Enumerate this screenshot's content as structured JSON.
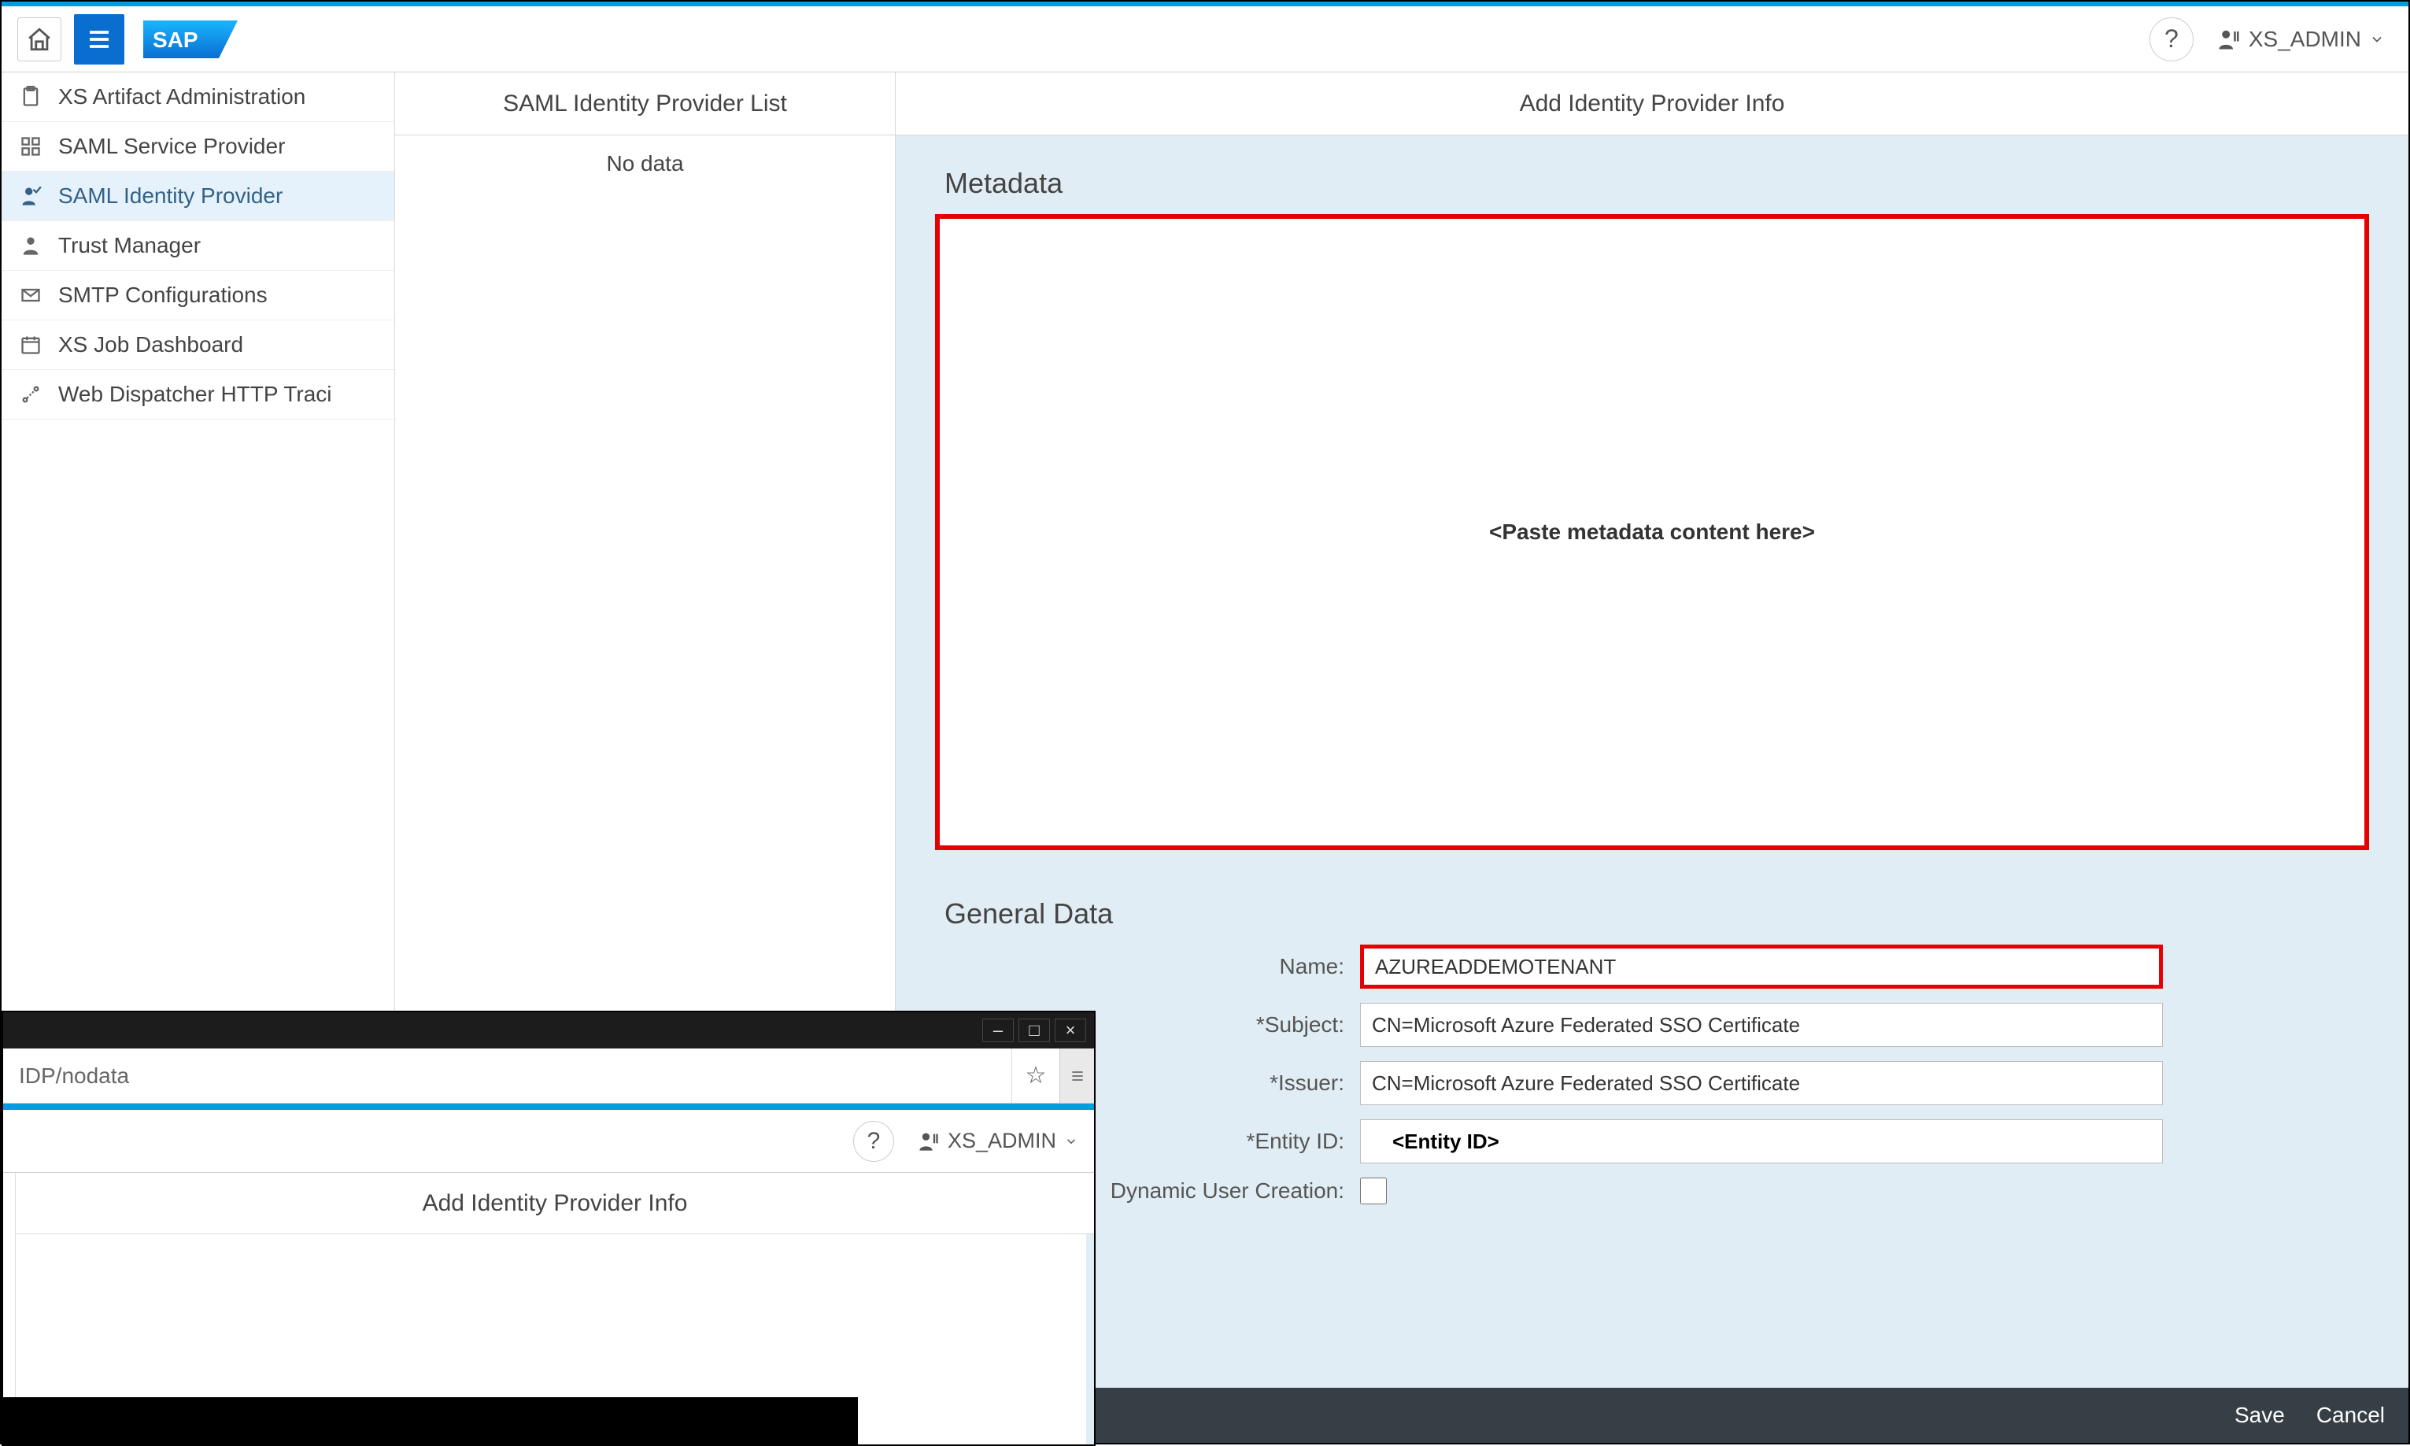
{
  "topbar": {
    "user_label": "XS_ADMIN"
  },
  "sidebar": {
    "items": [
      {
        "label": "XS Artifact Administration"
      },
      {
        "label": "SAML Service Provider"
      },
      {
        "label": "SAML Identity Provider"
      },
      {
        "label": "Trust Manager"
      },
      {
        "label": "SMTP Configurations"
      },
      {
        "label": "XS Job Dashboard"
      },
      {
        "label": "Web Dispatcher HTTP Traci"
      }
    ]
  },
  "list": {
    "header": "SAML Identity Provider List",
    "empty_text": "No data"
  },
  "detail": {
    "header": "Add Identity Provider Info",
    "metadata_title": "Metadata",
    "metadata_placeholder": "<Paste metadata content here>",
    "general_title": "General Data",
    "labels": {
      "name": "Name:",
      "subject": "*Subject:",
      "issuer": "*Issuer:",
      "entity_id": "*Entity ID:",
      "dynamic_user": "Dynamic User Creation:"
    },
    "values": {
      "name": "AZUREADDEMOTENANT",
      "subject": "CN=Microsoft Azure Federated SSO Certificate",
      "issuer": "CN=Microsoft Azure Federated SSO Certificate",
      "entity_id": "<Entity ID>"
    },
    "footer": {
      "save": "Save",
      "cancel": "Cancel"
    }
  },
  "overlay": {
    "url": "IDP/nodata",
    "user_label": "XS_ADMIN",
    "header": "Add Identity Provider Info"
  }
}
